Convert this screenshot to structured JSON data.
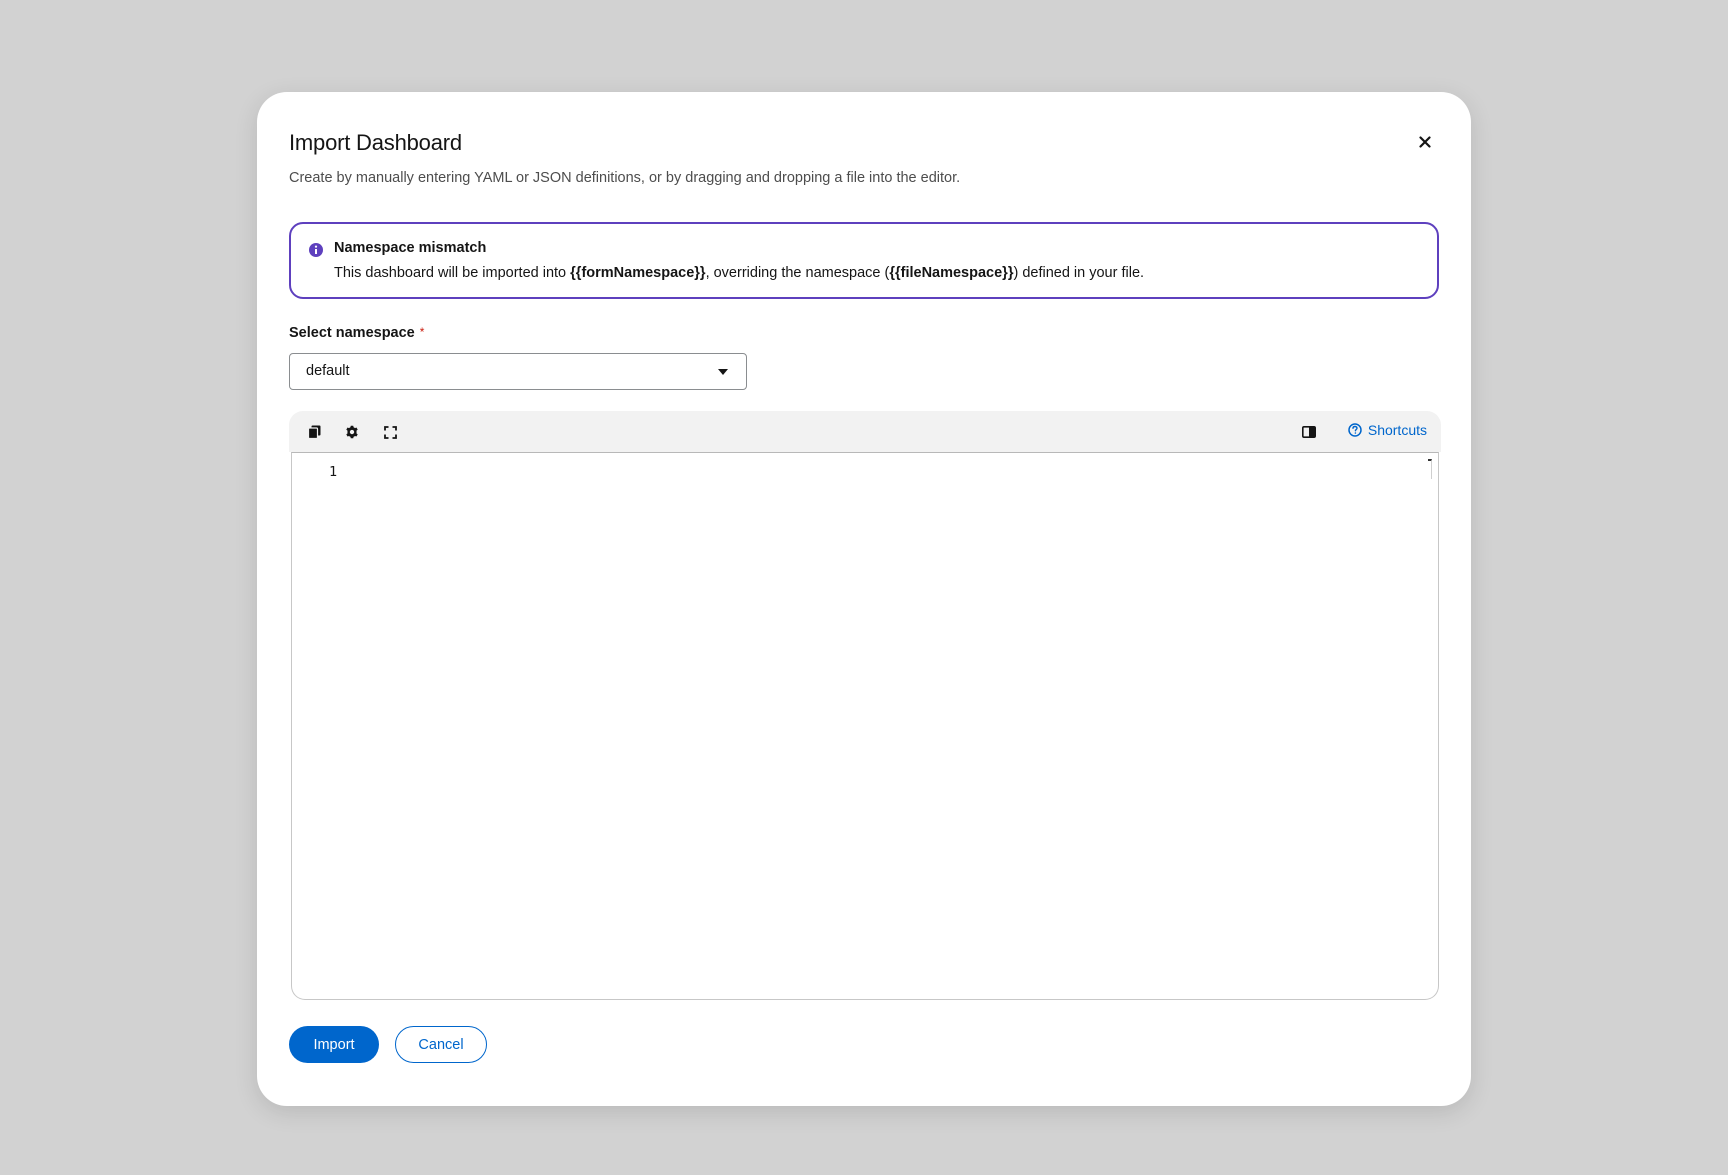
{
  "modal": {
    "title": "Import Dashboard",
    "description": "Create by manually entering YAML or JSON definitions, or by dragging and dropping a file into the editor."
  },
  "alert": {
    "title": "Namespace mismatch",
    "body_prefix": "This dashboard will be imported into ",
    "form_namespace": "{{formNamespace}}",
    "body_middle": ", overriding the namespace (",
    "file_namespace": "{{fileNamespace}}",
    "body_suffix": ") defined in your file."
  },
  "namespace_field": {
    "label": "Select namespace",
    "required_mark": "*",
    "selected_value": "default"
  },
  "editor": {
    "shortcuts_label": "Shortcuts",
    "line_numbers": [
      "1"
    ]
  },
  "actions": {
    "import_label": "Import",
    "cancel_label": "Cancel"
  },
  "colors": {
    "primary": "#0066cc",
    "alert_border": "#5e40be",
    "required": "#c9190b"
  },
  "icons": {
    "close": "close-icon",
    "info": "info-circle-icon",
    "copy": "copy-icon",
    "settings": "gear-icon",
    "fullscreen": "expand-icon",
    "sidebar": "split-view-icon",
    "help": "question-circle-icon",
    "caret": "caret-down-icon"
  }
}
